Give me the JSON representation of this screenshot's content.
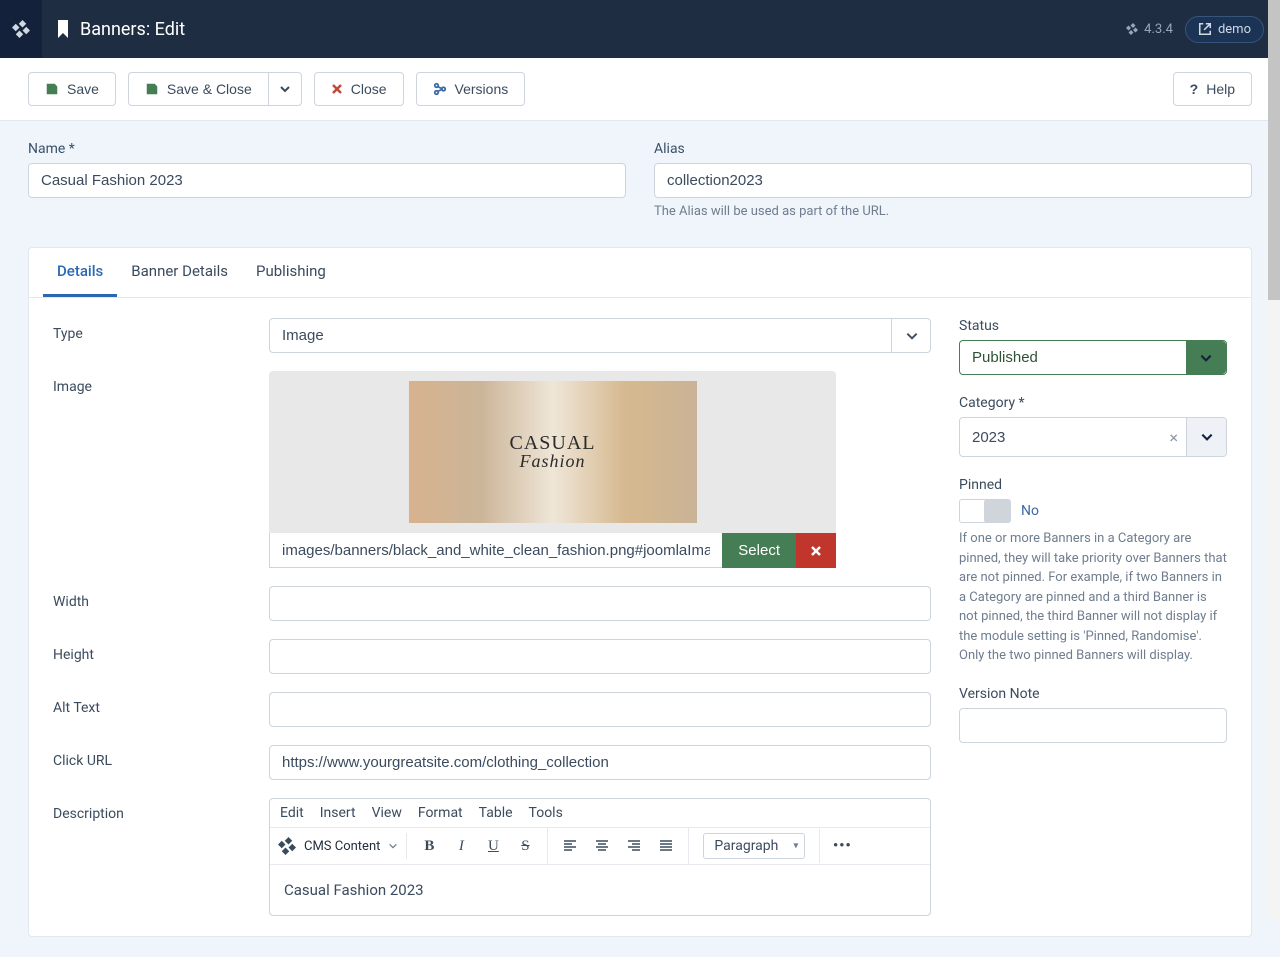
{
  "header": {
    "title": "Banners: Edit",
    "version": "4.3.4",
    "user": "demo"
  },
  "toolbar": {
    "save": "Save",
    "save_close": "Save & Close",
    "close": "Close",
    "versions": "Versions",
    "help": "Help"
  },
  "fields": {
    "name_label": "Name *",
    "name_value": "Casual Fashion 2023",
    "alias_label": "Alias",
    "alias_value": "collection2023",
    "alias_hint": "The Alias will be used as part of the URL."
  },
  "tabs": [
    "Details",
    "Banner Details",
    "Publishing"
  ],
  "active_tab": "Details",
  "details": {
    "type_label": "Type",
    "type_value": "Image",
    "image_label": "Image",
    "image_path": "images/banners/black_and_white_clean_fashion.png#joomlaImage",
    "select_btn": "Select",
    "preview_text_top": "CASUAL",
    "preview_text_bottom": "Fashion",
    "width_label": "Width",
    "width_value": "",
    "height_label": "Height",
    "height_value": "",
    "alt_label": "Alt Text",
    "alt_value": "",
    "clickurl_label": "Click URL",
    "clickurl_value": "https://www.yourgreatsite.com/clothing_collection",
    "description_label": "Description"
  },
  "editor": {
    "menus": [
      "Edit",
      "Insert",
      "View",
      "Format",
      "Table",
      "Tools"
    ],
    "cms_content": "CMS Content",
    "paragraph": "Paragraph",
    "content": "Casual Fashion 2023"
  },
  "sidebar": {
    "status_label": "Status",
    "status_value": "Published",
    "category_label": "Category *",
    "category_value": "2023",
    "pinned_label": "Pinned",
    "pinned_value": "No",
    "pinned_desc": "If one or more Banners in a Category are pinned, they will take priority over Banners that are not pinned. For example, if two Banners in a Category are pinned and a third Banner is not pinned, the third Banner will not display if the module setting is 'Pinned, Randomise'. Only the two pinned Banners will display.",
    "version_note_label": "Version Note",
    "version_note_value": ""
  }
}
